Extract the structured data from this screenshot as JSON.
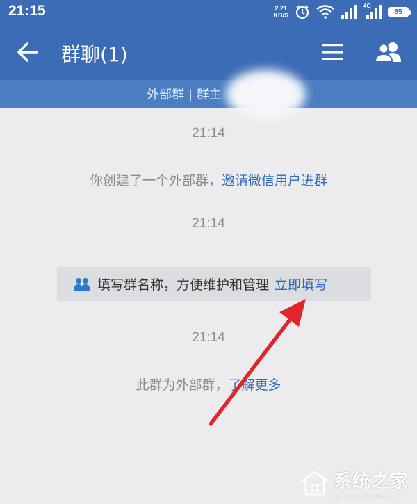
{
  "status_bar": {
    "time": "21:15",
    "net_speed_value": "2.21",
    "net_speed_unit": "KB/S",
    "network_type": "4G",
    "battery": "85",
    "icons": [
      "alarm-icon",
      "wifi-icon",
      "signal-icon",
      "signal-4g-icon",
      "battery-icon"
    ]
  },
  "nav": {
    "title": "群聊(1)",
    "icons": [
      "back-arrow-icon",
      "menu-icon",
      "group-members-icon"
    ]
  },
  "subbar": {
    "text": "外部群 | 群主"
  },
  "messages": {
    "time1": "21:14",
    "created_text": "你创建了一个外部群，",
    "invite_link": "邀请微信用户进群",
    "time2": "21:14",
    "tip_text": "填写群名称，方便维护和管理",
    "tip_link": "立即填写",
    "time3": "21:14",
    "external_text": "此群为外部群，",
    "learn_more_link": "了解更多"
  },
  "colors": {
    "header": "#3d6cb6",
    "subbar": "#4a7dc2",
    "background": "#ececef",
    "link": "#2e6bb8",
    "annotation_arrow": "#e0262b"
  },
  "watermark": {
    "main": "系统之家",
    "sub": "XITONGZHIJIA.NET"
  }
}
